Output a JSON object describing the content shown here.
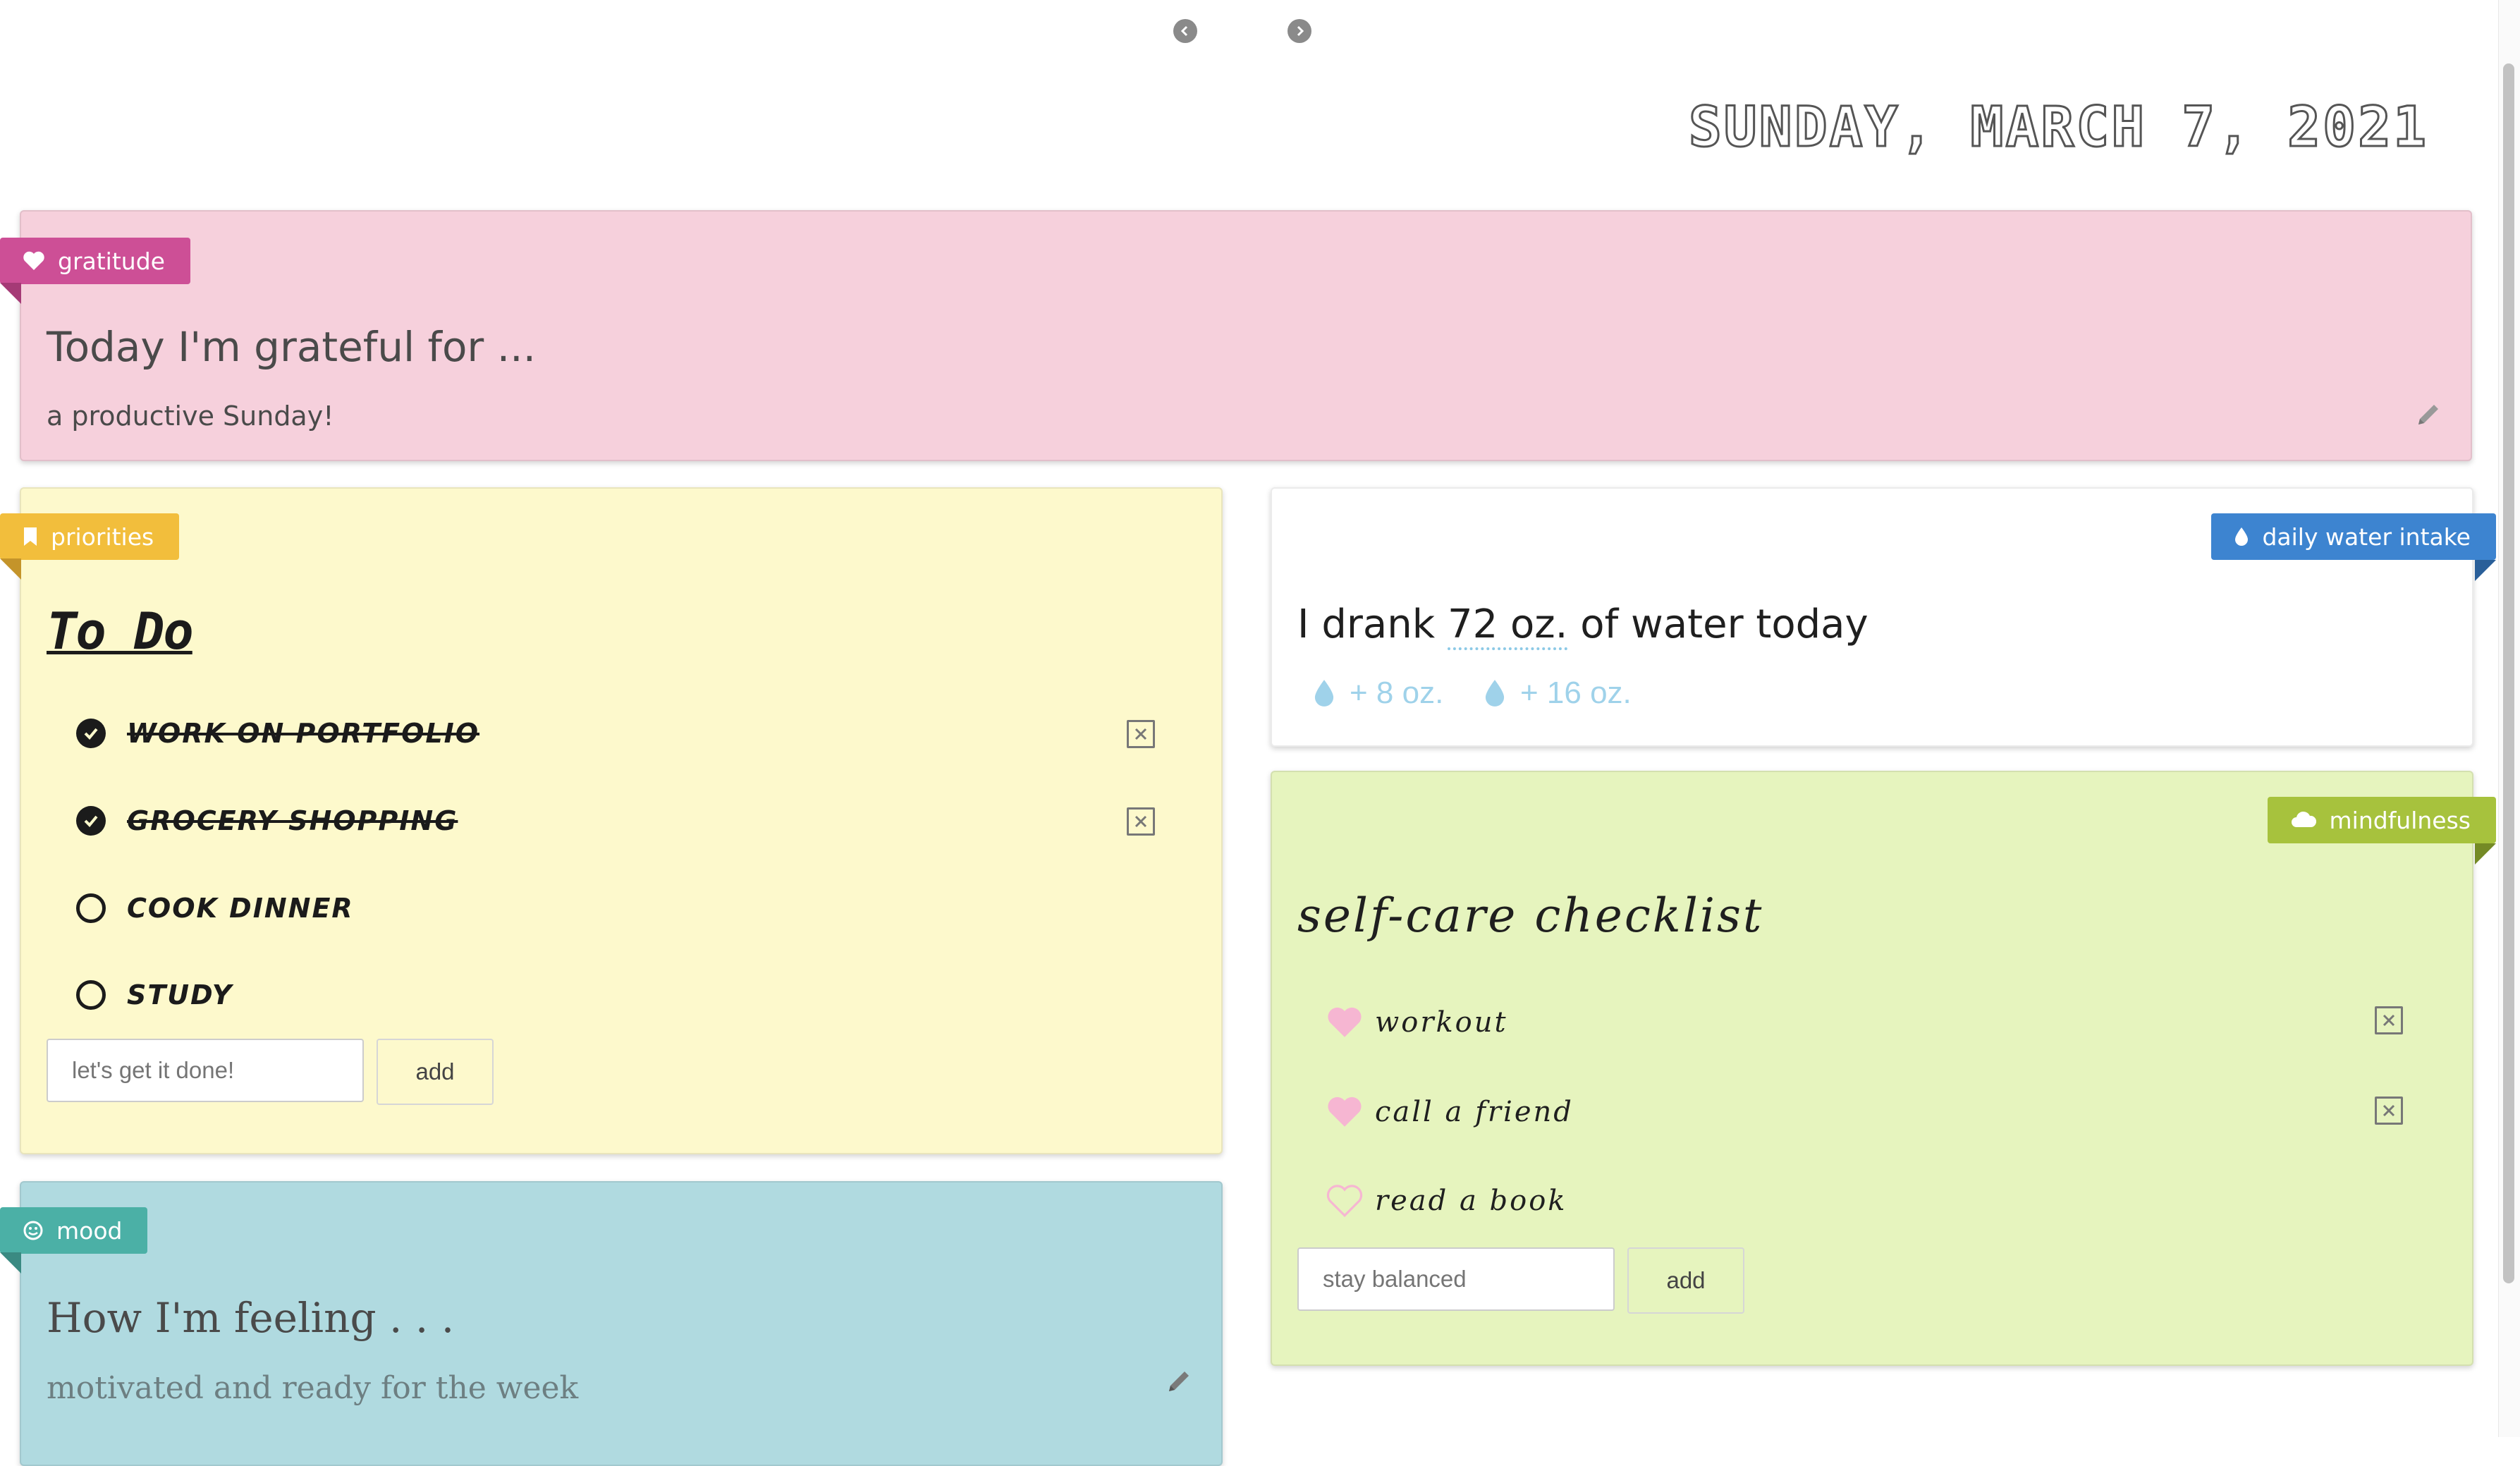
{
  "nav": {
    "prev_icon": "chevron-left-icon",
    "next_icon": "chevron-right-icon"
  },
  "date": "SUNDAY, MARCH 7, 2021",
  "gratitude": {
    "tag": "gratitude",
    "tag_icon": "heart-icon",
    "heading": "Today I'm grateful for ...",
    "text": "a productive Sunday!",
    "color": "#f6d0dc",
    "tag_color": "#cd4f96"
  },
  "priorities": {
    "tag": "priorities",
    "tag_icon": "bookmark-icon",
    "title": "To Do",
    "items": [
      {
        "label": "WORK ON PORTFOLIO",
        "done": true
      },
      {
        "label": "GROCERY SHOPPING",
        "done": true
      },
      {
        "label": "COOK DINNER",
        "done": false
      },
      {
        "label": "STUDY",
        "done": false
      }
    ],
    "input_placeholder": "let's get it done!",
    "add_label": "add",
    "color": "#fdf9cc",
    "tag_color": "#f2be3c"
  },
  "mood": {
    "tag": "mood",
    "tag_icon": "smiley-icon",
    "heading": "How I'm feeling . . .",
    "text": "motivated and ready for the week",
    "color": "#b0dae0",
    "tag_color": "#4bb0a6"
  },
  "water": {
    "tag": "daily water intake",
    "tag_icon": "droplet-icon",
    "text_prefix": "I drank",
    "amount": "72 oz.",
    "text_suffix": "of water today",
    "buttons": [
      "+ 8 oz.",
      "+ 16 oz."
    ],
    "tag_color": "#3d84d0"
  },
  "mindfulness": {
    "tag": "mindfulness",
    "tag_icon": "cloud-icon",
    "title": "self-care checklist",
    "items": [
      {
        "label": "workout",
        "done": true
      },
      {
        "label": "call a friend",
        "done": true
      },
      {
        "label": "read a book",
        "done": false
      }
    ],
    "input_placeholder": "stay balanced",
    "add_label": "add",
    "color": "#e6f4be",
    "tag_color": "#a7c23d"
  }
}
